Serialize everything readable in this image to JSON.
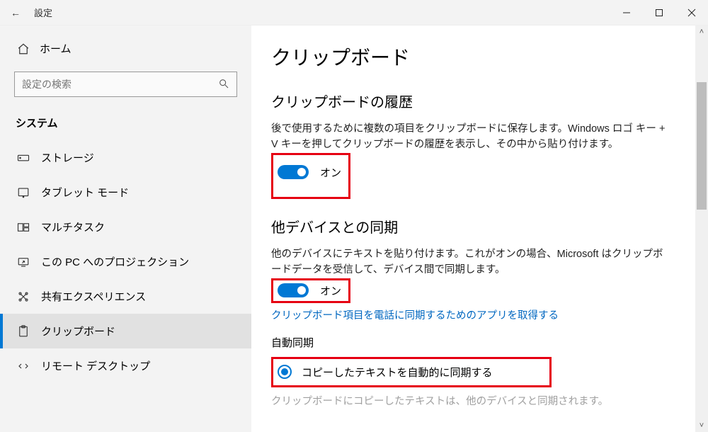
{
  "titlebar": {
    "back": "←",
    "title": "設定"
  },
  "sidebar": {
    "home_label": "ホーム",
    "search_placeholder": "設定の検索",
    "category": "システム",
    "items": [
      {
        "label": "ストレージ"
      },
      {
        "label": "タブレット モード"
      },
      {
        "label": "マルチタスク"
      },
      {
        "label": "この PC へのプロジェクション"
      },
      {
        "label": "共有エクスペリエンス"
      },
      {
        "label": "クリップボード"
      },
      {
        "label": "リモート デスクトップ"
      }
    ],
    "selected_index": 5
  },
  "main": {
    "page_title": "クリップボード",
    "section1": {
      "heading": "クリップボードの履歴",
      "desc": "後で使用するために複数の項目をクリップボードに保存します。Windows ロゴ キー + V キーを押してクリップボードの履歴を表示し、その中から貼り付けます。",
      "toggle_label": "オン"
    },
    "section2": {
      "heading": "他デバイスとの同期",
      "desc": "他のデバイスにテキストを貼り付けます。これがオンの場合、Microsoft はクリップボードデータを受信して、デバイス間で同期します。",
      "toggle_label": "オン",
      "link": "クリップボード項目を電話に同期するためのアプリを取得する",
      "subhead": "自動同期",
      "radio_label": "コピーしたテキストを自動的に同期する",
      "muted": "クリップボードにコピーしたテキストは、他のデバイスと同期されます。"
    }
  }
}
